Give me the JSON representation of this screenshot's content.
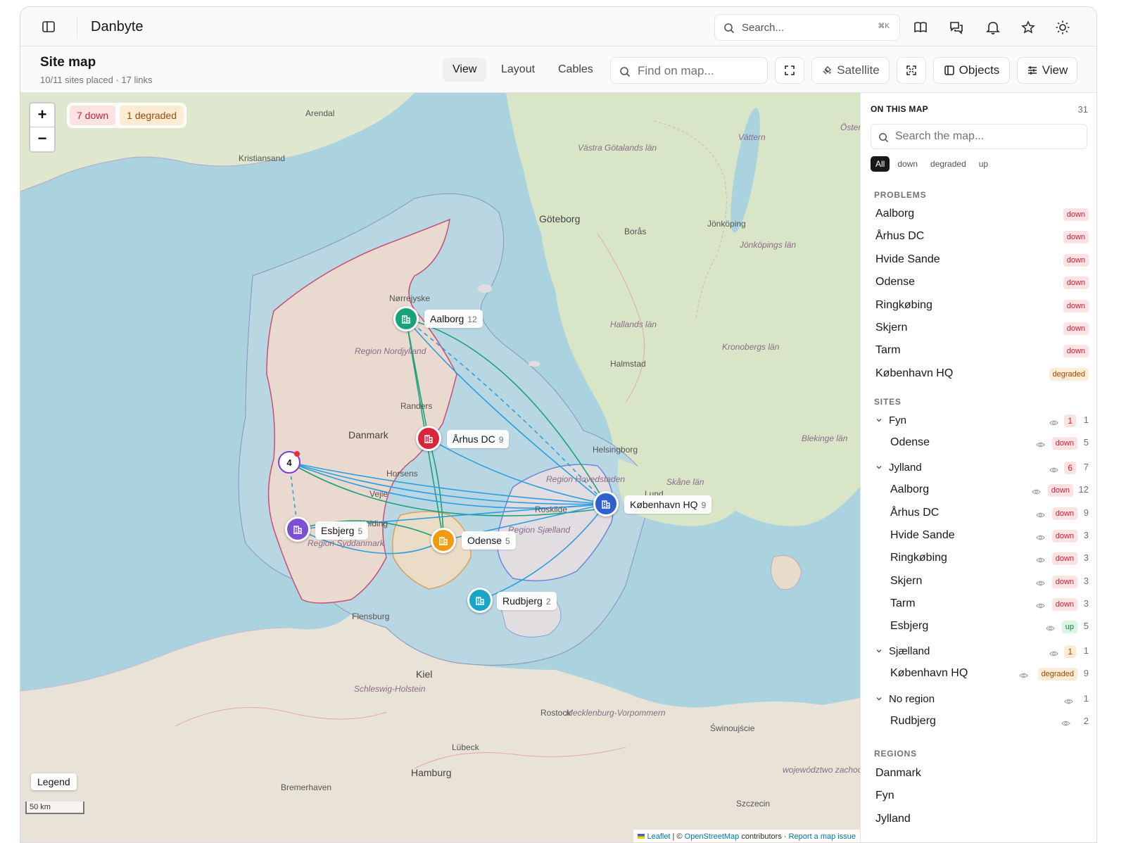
{
  "app": {
    "title": "Danbyte"
  },
  "topbar": {
    "search_placeholder": "Search...",
    "search_shortcut": "⌘K"
  },
  "page": {
    "title": "Site map",
    "subtitle": "10/11 sites placed · 17 links"
  },
  "tabs": [
    {
      "label": "View"
    },
    {
      "label": "Layout"
    },
    {
      "label": "Cables"
    }
  ],
  "active_tab": "View",
  "toolbar": {
    "find_placeholder": "Find on map...",
    "satellite_label": "Satellite",
    "objects_label": "Objects",
    "view_label": "View"
  },
  "map": {
    "status": {
      "down": "7 down",
      "degraded": "1 degraded"
    },
    "zoom_in": "+",
    "zoom_out": "−",
    "legend": "Legend",
    "scale": "50 km",
    "attribution": {
      "leaflet": "Leaflet",
      "sep1": " | © ",
      "osm": "OpenStreetMap",
      "contrib": " contributors · ",
      "report": "Report a map issue"
    },
    "cluster_count": "4",
    "sites": [
      {
        "name": "Aalborg",
        "count": "12",
        "status": "down",
        "color": "#1aa37a"
      },
      {
        "name": "Århus DC",
        "count": "9",
        "status": "down",
        "color": "#d9263d"
      },
      {
        "name": "Esbjerg",
        "count": "5",
        "status": "up",
        "color": "#7c4fd6"
      },
      {
        "name": "Odense",
        "count": "5",
        "status": "down",
        "color": "#f29a12"
      },
      {
        "name": "København HQ",
        "count": "9",
        "status": "degraded",
        "color": "#2f5fd0"
      },
      {
        "name": "Rudbjerg",
        "count": "2",
        "status": "",
        "color": "#17a6c4"
      }
    ],
    "place_names": [
      "Arendal",
      "Kristiansand",
      "Göteborg",
      "Borås",
      "Jönköping",
      "Halmstad",
      "Helsingborg",
      "Lund",
      "Nørrejyske",
      "Randers",
      "Danmark",
      "Horsens",
      "Vejle",
      "Kolding",
      "Roskilde",
      "Flensburg",
      "Kiel",
      "Lübeck",
      "Rostock",
      "Hamburg",
      "Bremerhaven",
      "Szczecin",
      "Świnoujście"
    ],
    "region_names": [
      "Region Nordjylland",
      "Region Syddanmark",
      "Region Sjælland",
      "Region Hovedstaden",
      "Västra Götalands län",
      "Hallands län",
      "Kronobergs län",
      "Jönköpings län",
      "Skåne län",
      "Blekinge län",
      "Schleswig-Holstein",
      "Mecklenburg-Vorpommern",
      "województwo zachodniopomorskie",
      "Vättern",
      "Öster"
    ]
  },
  "panel": {
    "heading": "ON THIS MAP",
    "total": "31",
    "search_placeholder": "Search the map...",
    "filters": [
      "All",
      "down",
      "degraded",
      "up"
    ],
    "problems_heading": "PROBLEMS",
    "problems": [
      {
        "name": "Aalborg",
        "status": "down"
      },
      {
        "name": "Århus DC",
        "status": "down"
      },
      {
        "name": "Hvide Sande",
        "status": "down"
      },
      {
        "name": "Odense",
        "status": "down"
      },
      {
        "name": "Ringkøbing",
        "status": "down"
      },
      {
        "name": "Skjern",
        "status": "down"
      },
      {
        "name": "Tarm",
        "status": "down"
      },
      {
        "name": "København HQ",
        "status": "degraded"
      }
    ],
    "sites_heading": "SITES",
    "groups": [
      {
        "name": "Fyn",
        "badge": "1",
        "badge_kind": "down",
        "total": "1",
        "items": [
          {
            "name": "Odense",
            "status": "down",
            "count": "5"
          }
        ]
      },
      {
        "name": "Jylland",
        "badge": "6",
        "badge_kind": "down",
        "total": "7",
        "items": [
          {
            "name": "Aalborg",
            "status": "down",
            "count": "12"
          },
          {
            "name": "Århus DC",
            "status": "down",
            "count": "9"
          },
          {
            "name": "Hvide Sande",
            "status": "down",
            "count": "3"
          },
          {
            "name": "Ringkøbing",
            "status": "down",
            "count": "3"
          },
          {
            "name": "Skjern",
            "status": "down",
            "count": "3"
          },
          {
            "name": "Tarm",
            "status": "down",
            "count": "3"
          },
          {
            "name": "Esbjerg",
            "status": "up",
            "count": "5"
          }
        ]
      },
      {
        "name": "Sjælland",
        "badge": "1",
        "badge_kind": "degraded",
        "total": "1",
        "items": [
          {
            "name": "København HQ",
            "status": "degraded",
            "count": "9"
          }
        ]
      },
      {
        "name": "No region",
        "badge": "",
        "badge_kind": "",
        "total": "1",
        "items": [
          {
            "name": "Rudbjerg",
            "status": "",
            "count": "2"
          }
        ]
      }
    ],
    "regions_heading": "REGIONS",
    "regions": [
      "Danmark",
      "Fyn",
      "Jylland"
    ]
  }
}
